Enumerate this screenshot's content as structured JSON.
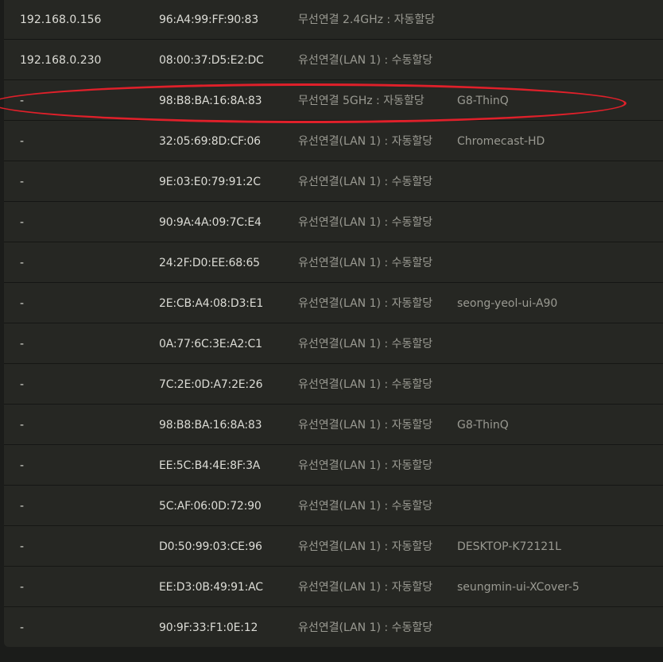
{
  "table": {
    "rows": [
      {
        "ip": "192.168.0.156",
        "mac": "96:A4:99:FF:90:83",
        "connection": "무선연결 2.4GHz : 자동할당",
        "name": ""
      },
      {
        "ip": "192.168.0.230",
        "mac": "08:00:37:D5:E2:DC",
        "connection": "유선연결(LAN 1) : 수동할당",
        "name": ""
      },
      {
        "ip": "-",
        "mac": "98:B8:BA:16:8A:83",
        "connection": "무선연결 5GHz : 자동할당",
        "name": "G8-ThinQ"
      },
      {
        "ip": "-",
        "mac": "32:05:69:8D:CF:06",
        "connection": "유선연결(LAN 1) : 자동할당",
        "name": "Chromecast-HD"
      },
      {
        "ip": "-",
        "mac": "9E:03:E0:79:91:2C",
        "connection": "유선연결(LAN 1) : 수동할당",
        "name": ""
      },
      {
        "ip": "-",
        "mac": "90:9A:4A:09:7C:E4",
        "connection": "유선연결(LAN 1) : 수동할당",
        "name": ""
      },
      {
        "ip": "-",
        "mac": "24:2F:D0:EE:68:65",
        "connection": "유선연결(LAN 1) : 수동할당",
        "name": ""
      },
      {
        "ip": "-",
        "mac": "2E:CB:A4:08:D3:E1",
        "connection": "유선연결(LAN 1) : 자동할당",
        "name": "seong-yeol-ui-A90"
      },
      {
        "ip": "-",
        "mac": "0A:77:6C:3E:A2:C1",
        "connection": "유선연결(LAN 1) : 수동할당",
        "name": ""
      },
      {
        "ip": "-",
        "mac": "7C:2E:0D:A7:2E:26",
        "connection": "유선연결(LAN 1) : 수동할당",
        "name": ""
      },
      {
        "ip": "-",
        "mac": "98:B8:BA:16:8A:83",
        "connection": "유선연결(LAN 1) : 자동할당",
        "name": "G8-ThinQ"
      },
      {
        "ip": "-",
        "mac": "EE:5C:B4:4E:8F:3A",
        "connection": "유선연결(LAN 1) : 자동할당",
        "name": ""
      },
      {
        "ip": "-",
        "mac": "5C:AF:06:0D:72:90",
        "connection": "유선연결(LAN 1) : 수동할당",
        "name": ""
      },
      {
        "ip": "-",
        "mac": "D0:50:99:03:CE:96",
        "connection": "유선연결(LAN 1) : 자동할당",
        "name": "DESKTOP-K72121L"
      },
      {
        "ip": "-",
        "mac": "EE:D3:0B:49:91:AC",
        "connection": "유선연결(LAN 1) : 자동할당",
        "name": "seungmin-ui-XCover-5"
      },
      {
        "ip": "-",
        "mac": "90:9F:33:F1:0E:12",
        "connection": "유선연결(LAN 1) : 수동할당",
        "name": ""
      }
    ]
  },
  "highlight": {
    "row_index": 2,
    "color": "#e0202a"
  }
}
